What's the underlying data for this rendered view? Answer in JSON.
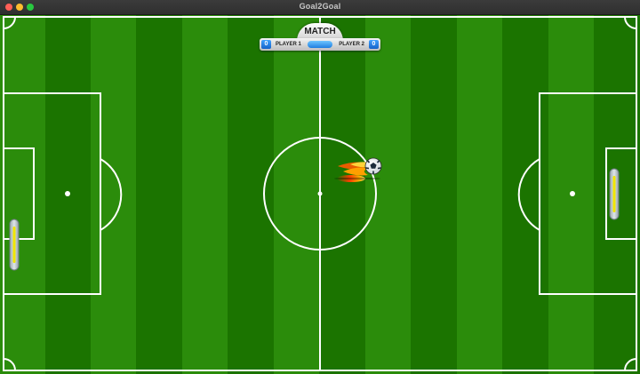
{
  "window": {
    "title": "Goal2Goal",
    "controls": {
      "close": "#ff5f57",
      "minimize": "#febc2e",
      "maximize": "#28c840"
    }
  },
  "scoreboard": {
    "label": "MATCH",
    "player1": {
      "name": "PLAYER 1",
      "score": "0"
    },
    "player2": {
      "name": "PLAYER 2",
      "score": "0"
    }
  },
  "colors": {
    "grass_dark": "#1b7400",
    "grass_light": "#2b8c0b",
    "lines": "#ffffff",
    "score_blue": "#1f7ee0"
  },
  "icons": {
    "ball": "soccer-ball-icon",
    "fire": "flame-trail-icon",
    "paddle": "goal-paddle-icon"
  }
}
